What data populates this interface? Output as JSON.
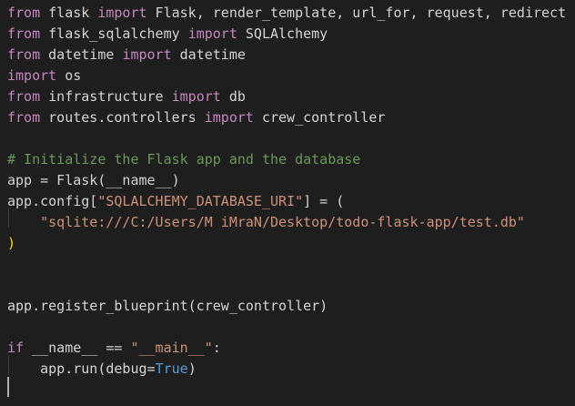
{
  "editor": {
    "lines": [
      [
        {
          "t": "from",
          "c": "kw"
        },
        {
          "t": " flask ",
          "c": "plain"
        },
        {
          "t": "import",
          "c": "kw"
        },
        {
          "t": " Flask, render_template, url_for, request, redirect",
          "c": "plain"
        }
      ],
      [
        {
          "t": "from",
          "c": "kw"
        },
        {
          "t": " flask_sqlalchemy ",
          "c": "plain"
        },
        {
          "t": "import",
          "c": "kw"
        },
        {
          "t": " SQLAlchemy",
          "c": "plain"
        }
      ],
      [
        {
          "t": "from",
          "c": "kw"
        },
        {
          "t": " datetime ",
          "c": "plain"
        },
        {
          "t": "import",
          "c": "kw"
        },
        {
          "t": " datetime",
          "c": "plain"
        }
      ],
      [
        {
          "t": "import",
          "c": "kw"
        },
        {
          "t": " os",
          "c": "plain"
        }
      ],
      [
        {
          "t": "from",
          "c": "kw"
        },
        {
          "t": " infrastructure ",
          "c": "plain"
        },
        {
          "t": "import",
          "c": "kw"
        },
        {
          "t": " db",
          "c": "plain"
        }
      ],
      [
        {
          "t": "from",
          "c": "kw"
        },
        {
          "t": " routes.controllers ",
          "c": "plain"
        },
        {
          "t": "import",
          "c": "kw"
        },
        {
          "t": " crew_controller",
          "c": "plain"
        }
      ],
      [],
      [
        {
          "t": "# Initialize the Flask app and the database",
          "c": "comment"
        }
      ],
      [
        {
          "t": "app = Flask(",
          "c": "plain"
        },
        {
          "t": "__name__",
          "c": "plain"
        },
        {
          "t": ")",
          "c": "plain"
        }
      ],
      [
        {
          "t": "app.config[",
          "c": "plain"
        },
        {
          "t": "\"SQLALCHEMY_DATABASE_URI\"",
          "c": "str"
        },
        {
          "t": "] = (",
          "c": "plain"
        }
      ],
      [
        {
          "t": "    ",
          "c": "plain"
        },
        {
          "t": "\"sqlite:///C:/Users/M iMraN/Desktop/todo-flask-app/test.db\"",
          "c": "str"
        }
      ],
      [
        {
          "t": ")",
          "c": "bracket"
        }
      ],
      [],
      [],
      [
        {
          "t": "app.register_blueprint(crew_controller)",
          "c": "plain"
        }
      ],
      [],
      [
        {
          "t": "if",
          "c": "kw"
        },
        {
          "t": " __name__ == ",
          "c": "plain"
        },
        {
          "t": "\"__main__\"",
          "c": "str"
        },
        {
          "t": ":",
          "c": "plain"
        }
      ],
      [
        {
          "t": "    app.run(debug=",
          "c": "plain"
        },
        {
          "t": "True",
          "c": "const"
        },
        {
          "t": ")",
          "c": "plain"
        }
      ],
      []
    ],
    "colors": {
      "kw": "#c586c0",
      "plain": "#d4d4d4",
      "comment": "#6a9955",
      "str": "#ce9178",
      "const": "#569cd6",
      "bracket": "#ffd700",
      "background": "#1e1e1e",
      "guide": "#404040",
      "cursor": "#aeafad"
    }
  }
}
